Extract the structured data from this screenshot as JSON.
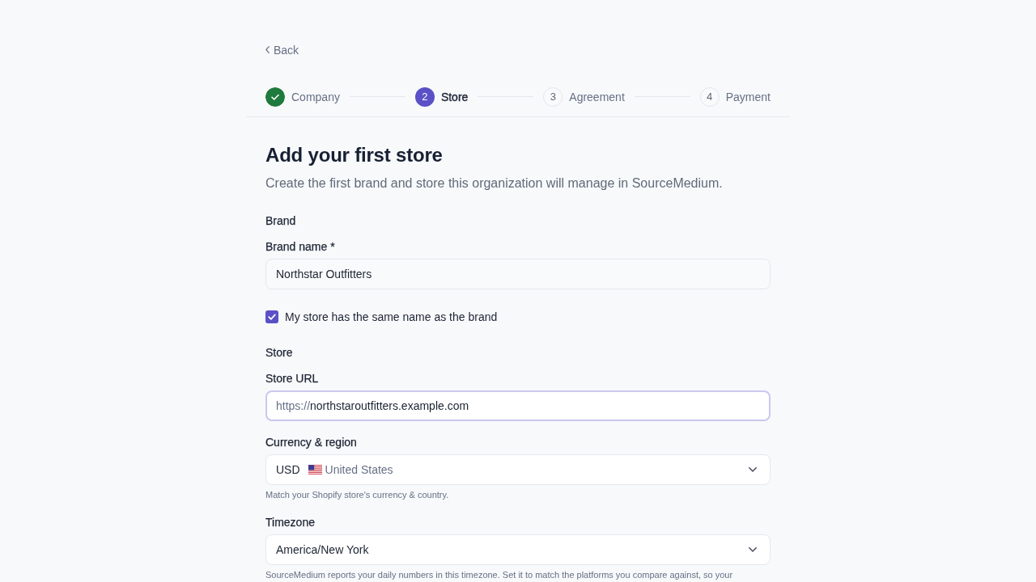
{
  "back_link": {
    "label": "Back"
  },
  "stepper": [
    {
      "label": "Company",
      "done": true,
      "selected": false
    },
    {
      "number": "2",
      "label": "Store",
      "done": false,
      "selected": true
    },
    {
      "number": "3",
      "label": "Agreement",
      "done": false,
      "selected": false
    },
    {
      "number": "4",
      "label": "Payment",
      "done": false,
      "selected": false
    }
  ],
  "form": {
    "title": "Add your first store",
    "subtitle": "Create the first brand and store this organization will manage in SourceMedium.",
    "sections": [
      {
        "heading": "Brand",
        "items": [
          {
            "kind": "text",
            "label": "Brand name *",
            "value": "Northstar Outfitters"
          },
          {
            "kind": "checkbox",
            "label": "My store has the same name as the brand",
            "checked": true
          }
        ]
      },
      {
        "heading": "Store",
        "items": [
          {
            "kind": "url",
            "label": "Store URL",
            "prefix": "https://",
            "value": "northstaroutfitters.example.com",
            "focused": true
          },
          {
            "kind": "select",
            "label": "Currency & region",
            "value": "USD",
            "detail": "United States",
            "help": "Match your Shopify store's currency & country."
          },
          {
            "kind": "select",
            "label": "Timezone",
            "value": "America/New York",
            "help": "SourceMedium reports your daily numbers in this timezone. Set it to match the platforms you compare against, so your"
          }
        ]
      }
    ]
  }
}
